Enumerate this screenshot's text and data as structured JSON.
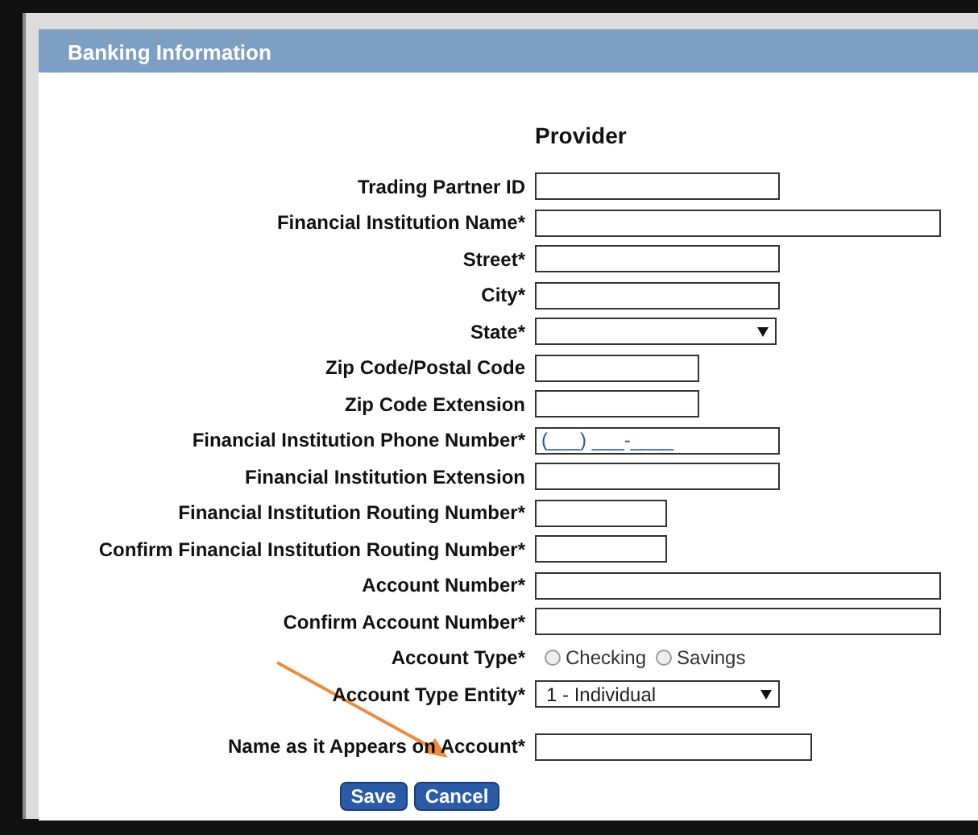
{
  "dialog": {
    "title": "Banking Information",
    "heading": "Provider"
  },
  "fields": [
    {
      "kind": "text",
      "label": "Trading Partner ID"
    },
    {
      "kind": "text",
      "label": "Financial Institution Name*"
    },
    {
      "kind": "text",
      "label": "Street*"
    },
    {
      "kind": "text",
      "label": "City*"
    },
    {
      "kind": "select",
      "label": "State*"
    },
    {
      "kind": "text",
      "label": "Zip Code/Postal Code"
    },
    {
      "kind": "text",
      "label": "Zip Code Extension"
    },
    {
      "kind": "text",
      "label": "Financial Institution Phone Number*",
      "value": "(___) ___-____"
    },
    {
      "kind": "text",
      "label": "Financial Institution Extension"
    },
    {
      "kind": "text",
      "label": "Financial Institution Routing Number*"
    },
    {
      "kind": "text",
      "label": "Confirm Financial Institution Routing Number*"
    },
    {
      "kind": "text",
      "label": "Account Number*"
    },
    {
      "kind": "text",
      "label": "Confirm Account Number*"
    },
    {
      "kind": "radio",
      "label": "Account Type*",
      "options": [
        {
          "label": "Checking",
          "selected": false
        },
        {
          "label": "Savings",
          "selected": false
        }
      ]
    },
    {
      "kind": "select",
      "label": "Account Type Entity*",
      "value": "1 - Individual"
    },
    {
      "kind": "text",
      "label": "Name as it Appears on Account*"
    }
  ],
  "buttons": [
    "Save",
    "Cancel"
  ]
}
